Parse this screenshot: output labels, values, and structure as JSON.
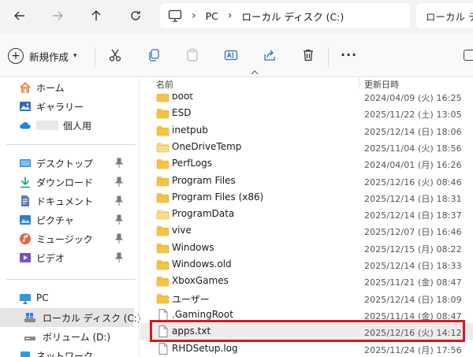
{
  "address": {
    "crumbs": [
      "PC",
      "ローカル ディスク (C:)"
    ],
    "search_placeholder": "ローカル ディスク"
  },
  "toolbar": {
    "new_label": "新規作成",
    "more_label": "···"
  },
  "list": {
    "col_name": "名前",
    "col_date": "更新日時",
    "rows": [
      {
        "name": "boot",
        "date": "2024/04/09 (火) 16:25",
        "type": "folder"
      },
      {
        "name": "ESD",
        "date": "2025/11/22 (土) 13:05",
        "type": "folder"
      },
      {
        "name": "inetpub",
        "date": "2025/12/14 (日) 18:06",
        "type": "folder"
      },
      {
        "name": "OneDriveTemp",
        "date": "2025/11/04 (火) 18:56",
        "type": "folder-light"
      },
      {
        "name": "PerfLogs",
        "date": "2024/04/01 (月) 16:26",
        "type": "folder"
      },
      {
        "name": "Program Files",
        "date": "2025/12/16 (火) 08:46",
        "type": "folder"
      },
      {
        "name": "Program Files (x86)",
        "date": "2025/12/14 (日) 18:31",
        "type": "folder"
      },
      {
        "name": "ProgramData",
        "date": "2025/12/14 (日) 18:37",
        "type": "folder-light"
      },
      {
        "name": "vive",
        "date": "2025/12/07 (日) 16:46",
        "type": "folder"
      },
      {
        "name": "Windows",
        "date": "2025/12/15 (月) 08:22",
        "type": "folder"
      },
      {
        "name": "Windows.old",
        "date": "2025/12/14 (日) 18:33",
        "type": "folder"
      },
      {
        "name": "XboxGames",
        "date": "2025/11/21 (金) 08:47",
        "type": "folder"
      },
      {
        "name": "ユーザー",
        "date": "2025/12/14 (日) 18:09",
        "type": "folder"
      },
      {
        "name": ".GamingRoot",
        "date": "2025/11/14 (金) 08:47",
        "type": "file"
      },
      {
        "name": "apps.txt",
        "date": "2025/12/16 (火) 14:12",
        "type": "file"
      },
      {
        "name": "RHDSetup.log",
        "date": "2025/11/24 (月) 17:56",
        "type": "file"
      }
    ]
  },
  "sidebar": {
    "home": "ホーム",
    "gallery": "ギャラリー",
    "personal": "個人用",
    "desktop": "デスクトップ",
    "downloads": "ダウンロード",
    "documents": "ドキュメント",
    "pictures": "ピクチャ",
    "music": "ミュージック",
    "videos": "ビデオ",
    "pc": "PC",
    "local_disk": "ローカル ディスク (C:)",
    "volume_d": "ボリューム (D:)",
    "network": "ネットワーク"
  },
  "colors": {
    "folder": "#f6c445",
    "folder_light": "#f9dd8c",
    "highlight_border": "#e0141e",
    "selected_bg": "#e5e5e5"
  }
}
